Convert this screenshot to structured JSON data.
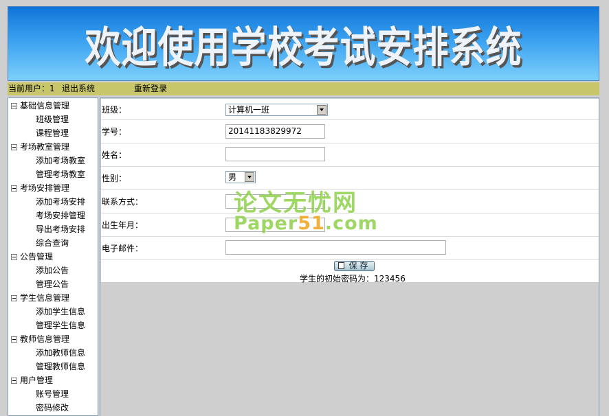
{
  "banner": {
    "title": "欢迎使用学校考试安排系统"
  },
  "userbar": {
    "current_user_label": "当前用户：",
    "current_user_value": "1",
    "logout": "退出系统",
    "relogin": "重新登录"
  },
  "sidebar": {
    "groups": [
      {
        "label": "基础信息管理",
        "items": [
          "班级管理",
          "课程管理"
        ]
      },
      {
        "label": "考场教室管理",
        "items": [
          "添加考场教室",
          "管理考场教室"
        ]
      },
      {
        "label": "考场安排管理",
        "items": [
          "添加考场安排",
          "考场安排管理",
          "导出考场安排",
          "综合查询"
        ]
      },
      {
        "label": "公告管理",
        "items": [
          "添加公告",
          "管理公告"
        ]
      },
      {
        "label": "学生信息管理",
        "items": [
          "添加学生信息",
          "管理学生信息"
        ]
      },
      {
        "label": "教师信息管理",
        "items": [
          "添加教师信息",
          "管理教师信息"
        ]
      },
      {
        "label": "用户管理",
        "items": [
          "账号管理",
          "密码修改"
        ]
      }
    ]
  },
  "form": {
    "class_label": "班级：",
    "class_value": "计算机一班",
    "student_no_label": "学号：",
    "student_no_value": "20141183829972",
    "name_label": "姓名：",
    "name_value": "",
    "gender_label": "性别：",
    "gender_value": "男",
    "contact_label": "联系方式：",
    "contact_value": "",
    "birth_label": "出生年月：",
    "birth_value": "",
    "email_label": "电子邮件：",
    "email_value": "",
    "save_label": "保 存",
    "password_note_label": "学生的初始密码为：",
    "password_note_value": "123456"
  },
  "watermark": {
    "line1": "论文无忧网",
    "line2_a": "Paper",
    "line2_b": "51",
    "line2_c": ".com"
  }
}
